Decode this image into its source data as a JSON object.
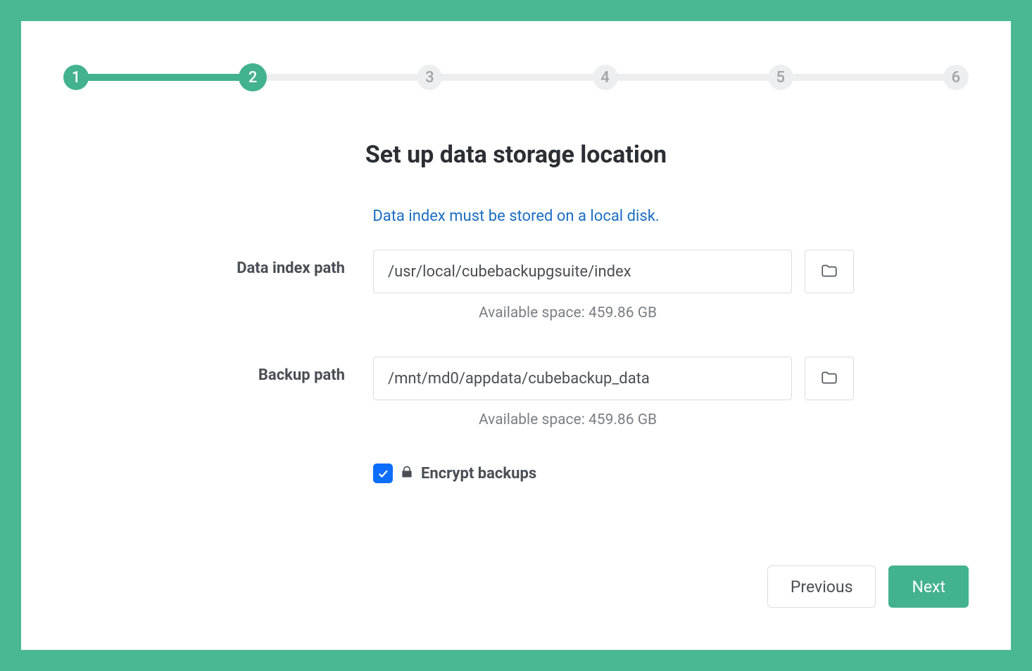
{
  "colors": {
    "accent": "#43b28e",
    "link": "#1b6ec2",
    "checkbox": "#0d6efd"
  },
  "stepper": {
    "total": 6,
    "current": 2,
    "labels": [
      "1",
      "2",
      "3",
      "4",
      "5",
      "6"
    ]
  },
  "title": "Set up data storage location",
  "info": "Data index must be stored on a local disk.",
  "fields": {
    "data_index": {
      "label": "Data index path",
      "value": "/usr/local/cubebackupgsuite/index",
      "hint": "Available space: 459.86 GB"
    },
    "backup_path": {
      "label": "Backup path",
      "value": "/mnt/md0/appdata/cubebackup_data",
      "hint": "Available space: 459.86 GB"
    }
  },
  "encrypt": {
    "checked": true,
    "label": "Encrypt backups"
  },
  "buttons": {
    "previous": "Previous",
    "next": "Next"
  }
}
